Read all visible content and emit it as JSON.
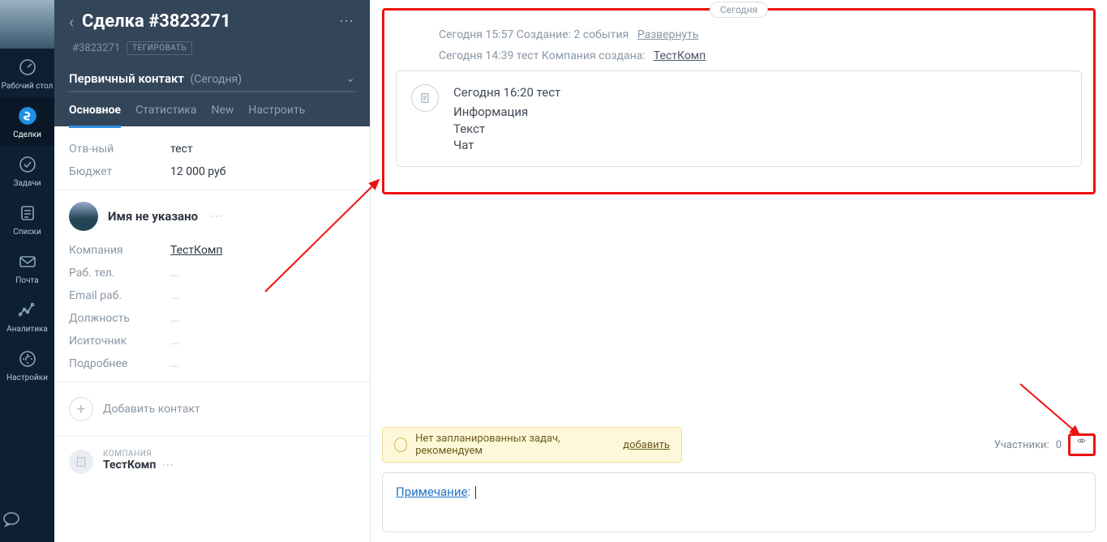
{
  "rail": {
    "items": [
      {
        "label": "Рабочий стол",
        "icon": "dashboard-icon"
      },
      {
        "label": "Сделки",
        "icon": "deals-icon",
        "active": true
      },
      {
        "label": "Задачи",
        "icon": "tasks-icon"
      },
      {
        "label": "Списки",
        "icon": "lists-icon"
      },
      {
        "label": "Почта",
        "icon": "mail-icon"
      },
      {
        "label": "Аналитика",
        "icon": "analytics-icon"
      },
      {
        "label": "Настройки",
        "icon": "settings-icon"
      }
    ],
    "bottom_icon": "chat-icon"
  },
  "deal": {
    "title": "Сделка #3823271",
    "id": "#3823271",
    "tag_button": "ТЕГИРОВАТЬ",
    "stage_label": "Первичный контакт",
    "stage_sub": "(Сегодня)",
    "tabs": [
      "Основное",
      "Статистика",
      "New",
      "Настроить"
    ],
    "responsible_label": "Отв-ный",
    "responsible_value": "тест",
    "budget_label": "Бюджет",
    "budget_value": "12 000 руб"
  },
  "contact": {
    "name": "Имя не указано",
    "fields": {
      "company_label": "Компания",
      "company_value": "ТестКомп",
      "phone_label": "Раб. тел.",
      "phone_value": "...",
      "email_label": "Email раб.",
      "email_value": "...",
      "position_label": "Должность",
      "position_value": "...",
      "source_label": "Иситочник",
      "source_value": "...",
      "more_label": "Подробнее",
      "more_value": "..."
    },
    "add_label": "Добавить контакт"
  },
  "company": {
    "badge_label": "КОМПАНИЯ",
    "name": "ТестКомп"
  },
  "feed": {
    "pill": "Сегодня",
    "line1_prefix": "Сегодня 15:57 Создание: 2 события",
    "line1_link": "Развернуть",
    "line2_prefix": "Сегодня 14:39 тест  Компания создана:",
    "line2_link": "ТестКомп",
    "note": {
      "meta": "Сегодня 16:20 тест",
      "lines": [
        "Информация",
        "Текст",
        "Чат"
      ]
    }
  },
  "bottom": {
    "task_text": "Нет запланированных задач, рекомендуем",
    "task_link": "добавить",
    "participants_label": "Участники:",
    "participants_count": "0",
    "note_label": "Примечание"
  }
}
